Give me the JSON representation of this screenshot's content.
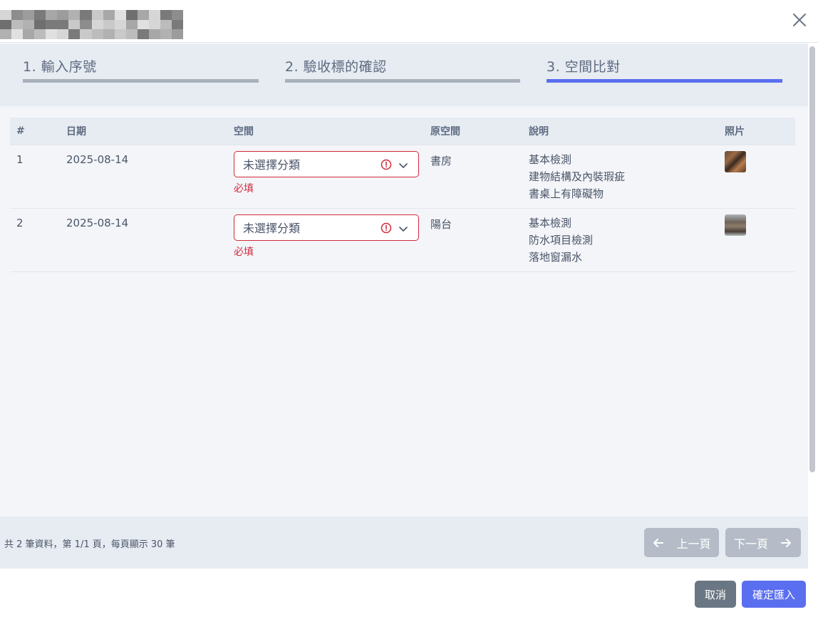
{
  "steps": [
    {
      "label": "1. 輸入序號",
      "active": false
    },
    {
      "label": "2. 驗收標的確認",
      "active": false
    },
    {
      "label": "3. 空間比對",
      "active": true
    }
  ],
  "table": {
    "columns": [
      "#",
      "日期",
      "空間",
      "原空間",
      "說明",
      "照片"
    ],
    "rows": [
      {
        "index": "1",
        "date": "2025-08-14",
        "space_value": "未選擇分類",
        "space_error": "必填",
        "original_space": "書房",
        "description": [
          "基本檢測",
          "建物結構及內裝瑕疵",
          "書桌上有障礙物"
        ],
        "photo": "photo-thumbnail"
      },
      {
        "index": "2",
        "date": "2025-08-14",
        "space_value": "未選擇分類",
        "space_error": "必填",
        "original_space": "陽台",
        "description": [
          "基本檢測",
          "防水項目檢測",
          "落地窗漏水"
        ],
        "photo": "photo-thumbnail"
      }
    ]
  },
  "pagination": {
    "summary": "共 2 筆資料，第 1/1 頁，每頁顯示 30 筆",
    "prev_label": "上一頁",
    "next_label": "下一頁"
  },
  "actions": {
    "cancel_label": "取消",
    "confirm_label": "確定匯入"
  },
  "icons": {
    "close": "close-icon",
    "alert": "alert-circle-icon",
    "chevron": "chevron-down-icon",
    "prev": "arrow-left-icon",
    "next": "arrow-right-icon"
  },
  "colors": {
    "accent": "#5a6ef0",
    "error": "#d12a3a",
    "step_inactive": "#a8b0bb",
    "cancel": "#6b7684",
    "pager_disabled": "#b5bcc7"
  }
}
